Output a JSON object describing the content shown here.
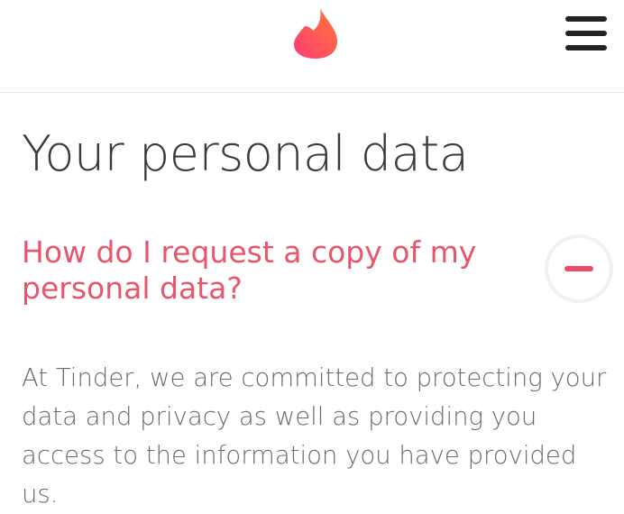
{
  "header": {
    "logo_icon": "tinder-flame-icon",
    "menu_icon": "hamburger-menu-icon",
    "brand_gradient": [
      "#fd267a",
      "#ff6036"
    ]
  },
  "main": {
    "title": "Your personal data",
    "faq": {
      "question": "How do I request a copy of my personal data?",
      "toggle_icon": "minus-icon",
      "expanded": true,
      "answer": "At Tinder, we are committed to protecting your data and privacy as well as providing you access to the information you have provided us."
    }
  },
  "colors": {
    "question": "#e8566c",
    "title": "#3a3a3a",
    "body_text": "#6b6b6f",
    "accent": "#ea4a66"
  }
}
